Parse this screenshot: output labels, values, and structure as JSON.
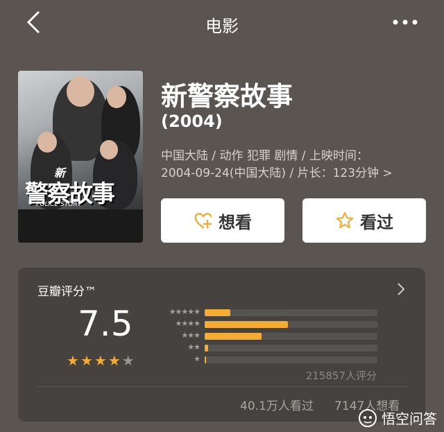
{
  "header": {
    "title": "电影"
  },
  "movie": {
    "poster_title": "警察故事",
    "poster_subtitle": "POLICE STORY",
    "poster_new": "新",
    "name": "新警察故事",
    "year": "(2004)",
    "meta_line1": "中国大陆 / 动作 犯罪 剧情 / 上映时间：",
    "meta_line2": "2004-09-24(中国大陆) / 片长：123分钟 >"
  },
  "actions": {
    "want_label": "想看",
    "seen_label": "看过"
  },
  "rating": {
    "title": "豆瓣评分™",
    "score": "7.5",
    "stars": 4,
    "count_text": "215857人评分",
    "star_labels": [
      "★★★★★",
      "★★★★",
      "★★★",
      "★★",
      "★"
    ],
    "distribution": [
      0.15,
      0.48,
      0.33,
      0.02,
      0.005
    ],
    "seen_count": "40.1万人看过",
    "want_count": "7147人想看"
  },
  "watermark": {
    "text": "悟空问答"
  },
  "colors": {
    "accent": "#f6ab33",
    "background": "#5a5551",
    "card": "#464240"
  }
}
